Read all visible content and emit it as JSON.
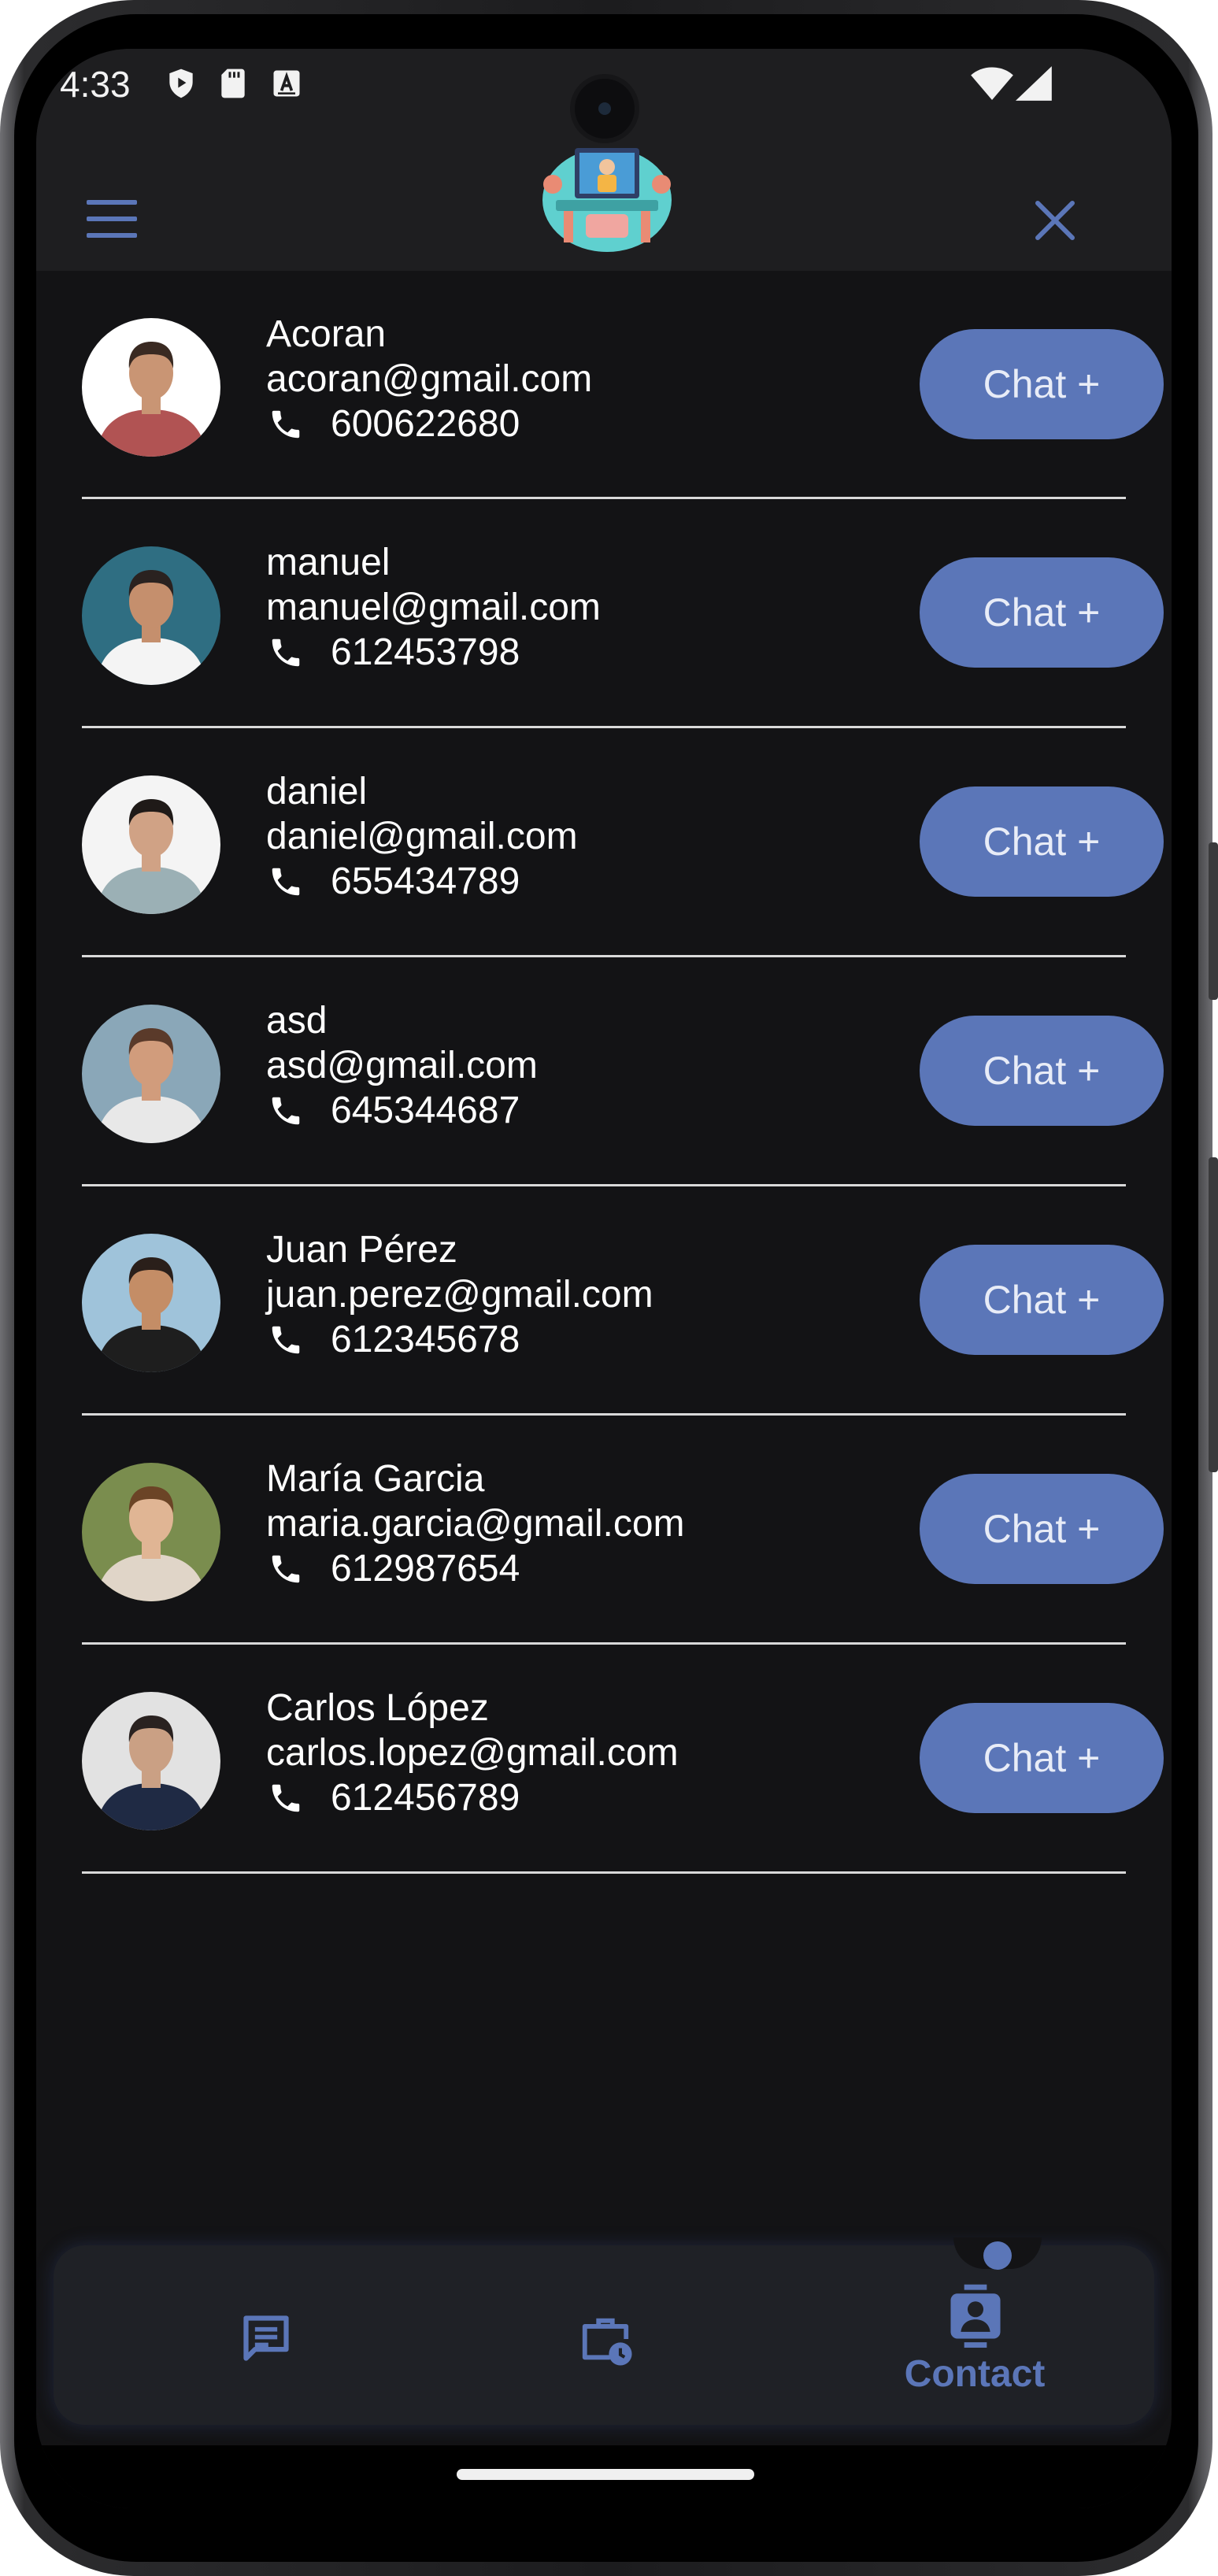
{
  "status_bar": {
    "time": "4:33",
    "left_icons": [
      "shield-play-icon",
      "sd-card-icon",
      "keyboard-a-icon"
    ],
    "right_icons": [
      "wifi-icon",
      "signal-icon"
    ]
  },
  "app_bar": {
    "menu_icon": "hamburger-menu-icon",
    "logo_icon": "workspace-logo-icon",
    "close_icon": "close-icon"
  },
  "contacts": [
    {
      "name": "Acoran",
      "email": "acoran@gmail.com",
      "phone": "600622680",
      "button": "Chat +",
      "avatar_bg": "#ffffff",
      "shirt": "#b15353",
      "skin": "#c99574",
      "hair": "#3a2a22"
    },
    {
      "name": "manuel",
      "email": "manuel@gmail.com",
      "phone": "612453798",
      "button": "Chat +",
      "avatar_bg": "#2f6e82",
      "shirt": "#f4f4f4",
      "skin": "#c58f6d",
      "hair": "#2a2220"
    },
    {
      "name": "daniel",
      "email": "daniel@gmail.com",
      "phone": "655434789",
      "button": "Chat +",
      "avatar_bg": "#f4f4f4",
      "shirt": "#9bb0b5",
      "skin": "#d0a285",
      "hair": "#1f1a18"
    },
    {
      "name": "asd",
      "email": "asd@gmail.com",
      "phone": "645344687",
      "button": "Chat +",
      "avatar_bg": "#8aa7b8",
      "shirt": "#e8e8e8",
      "skin": "#d19c7c",
      "hair": "#5a3a2a"
    },
    {
      "name": "Juan Pérez",
      "email": "juan.perez@gmail.com",
      "phone": "612345678",
      "button": "Chat +",
      "avatar_bg": "#9fc3da",
      "shirt": "#1e1e1e",
      "skin": "#c48d66",
      "hair": "#2a1f1a"
    },
    {
      "name": "María Garcia",
      "email": "maria.garcia@gmail.com",
      "phone": "612987654",
      "button": "Chat +",
      "avatar_bg": "#7a8d4e",
      "shirt": "#e0d5c8",
      "skin": "#e0b594",
      "hair": "#6b4426"
    },
    {
      "name": "Carlos López",
      "email": "carlos.lopez@gmail.com",
      "phone": "612456789",
      "button": "Chat +",
      "avatar_bg": "#e2e2e2",
      "shirt": "#1f2a44",
      "skin": "#caa084",
      "hair": "#2a2220"
    }
  ],
  "bottom_nav": {
    "items": [
      {
        "icon": "chat-message-icon",
        "label": ""
      },
      {
        "icon": "briefcase-clock-icon",
        "label": ""
      },
      {
        "icon": "contact-badge-icon",
        "label": "Contact",
        "active": true
      }
    ]
  },
  "colors": {
    "accent": "#5b76b8",
    "background": "#131315",
    "app_bar": "#1e1e20",
    "divider": "#d9d9d9",
    "text": "#ffffff"
  }
}
